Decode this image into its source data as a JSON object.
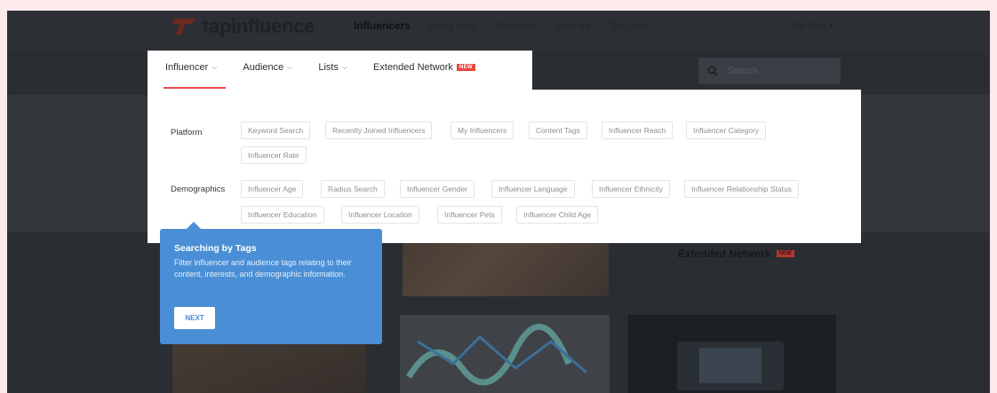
{
  "brand": {
    "name": "tapinfluence"
  },
  "topnav": {
    "items": [
      "Influencers",
      "Programs",
      "Analytics",
      "TapFire",
      "Support"
    ],
    "active": "Influencers"
  },
  "user_menu": {
    "label": "Test User ▾"
  },
  "search": {
    "placeholder": "Search"
  },
  "tabs": [
    {
      "label": "Influencer"
    },
    {
      "label": "Audience"
    },
    {
      "label": "Lists"
    },
    {
      "label": "Extended Network",
      "badge": "NEW"
    }
  ],
  "filters": {
    "platform": {
      "label": "Platform",
      "chips": [
        "Keyword Search",
        "Recently Joined Influencers",
        "My Influencers",
        "Content Tags",
        "Influencer Reach",
        "Influencer Category",
        "Influencer Rate"
      ]
    },
    "demographics": {
      "label": "Demographics",
      "chips": [
        "Influencer Age",
        "Radius Search",
        "Influencer Gender",
        "Influencer Language",
        "Influencer Ethnicity",
        "Influencer Relationship Status",
        "Influencer Education",
        "Influencer Location",
        "Influencer Pets",
        "Influencer Child Age"
      ]
    }
  },
  "background_cards": {
    "extended_network": {
      "label": "Extended Network",
      "badge": "NEW"
    }
  },
  "tooltip": {
    "title": "Searching by Tags",
    "body": "Filter influencer and audience tags relating to their content, interests, and demographic information.",
    "next_label": "NEXT"
  },
  "colors": {
    "accent_red": "#e94b4b",
    "tooltip_blue": "#4a8fd6",
    "page_bg": "#fce9ec"
  }
}
